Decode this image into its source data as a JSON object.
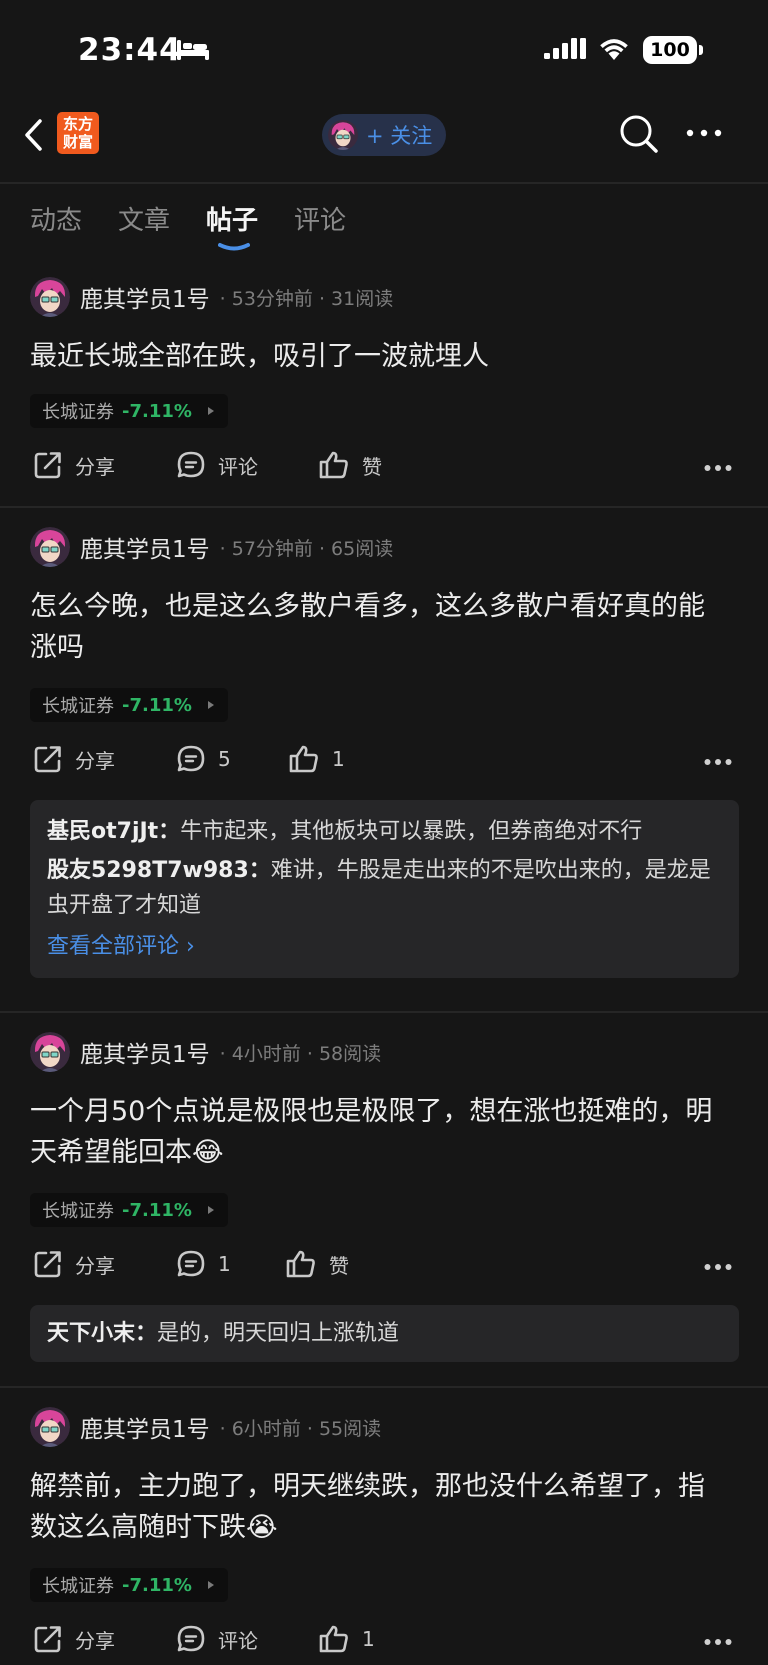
{
  "status_bar": {
    "time": "23:44",
    "battery": "100"
  },
  "header": {
    "logo_text": "东方财富",
    "follow_label": "+ 关注"
  },
  "tabs": [
    {
      "label": "动态"
    },
    {
      "label": "文章"
    },
    {
      "label": "帖子"
    },
    {
      "label": "评论"
    }
  ],
  "posts": [
    {
      "username": "鹿其学员1号",
      "time": "53分钟前",
      "reads": "31阅读",
      "content": "最近长城全部在跌，吸引了一波就埋人",
      "stock": {
        "name": "长城证券",
        "change": "-7.11%"
      },
      "share_label": "分享",
      "comment_label": "评论",
      "like_label": "赞"
    },
    {
      "username": "鹿其学员1号",
      "time": "57分钟前",
      "reads": "65阅读",
      "content": "怎么今晚，也是这么多散户看多，这么多散户看好真的能涨吗",
      "stock": {
        "name": "长城证券",
        "change": "-7.11%"
      },
      "share_label": "分享",
      "comment_label": "5",
      "like_label": "1",
      "comments": [
        {
          "user": "基民ot7jJt：",
          "text": "牛市起来，其他板块可以暴跌，但券商绝对不行"
        },
        {
          "user": "股友5298T7w983：",
          "text": "难讲，牛股是走出来的不是吹出来的，是龙是虫开盘了才知道"
        }
      ],
      "view_all": "查看全部评论 ›"
    },
    {
      "username": "鹿其学员1号",
      "time": "4小时前",
      "reads": "58阅读",
      "content": "一个月50个点说是极限也是极限了，想在涨也挺难的，明天希望能回本",
      "content_emoji": "😂",
      "stock": {
        "name": "长城证券",
        "change": "-7.11%"
      },
      "share_label": "分享",
      "comment_label": "1",
      "like_label": "赞",
      "comments": [
        {
          "user": "天下小末：",
          "text": "是的，明天回归上涨轨道"
        }
      ]
    },
    {
      "username": "鹿其学员1号",
      "time": "6小时前",
      "reads": "55阅读",
      "content": "解禁前，主力跑了，明天继续跌，那也没什么希望了，指数这么高随时下跌",
      "content_emoji": "😭",
      "stock": {
        "name": "长城证券",
        "change": "-7.11%"
      },
      "share_label": "分享",
      "comment_label": "评论",
      "like_label": "1"
    }
  ],
  "icons": {
    "share": "share-icon",
    "comment": "comment-icon",
    "like": "thumbs-up-icon",
    "more": "more-icon"
  },
  "colors": {
    "accent_blue": "#4a8fe6",
    "stock_down": "#2fb565",
    "logo": "#f05a1e"
  }
}
